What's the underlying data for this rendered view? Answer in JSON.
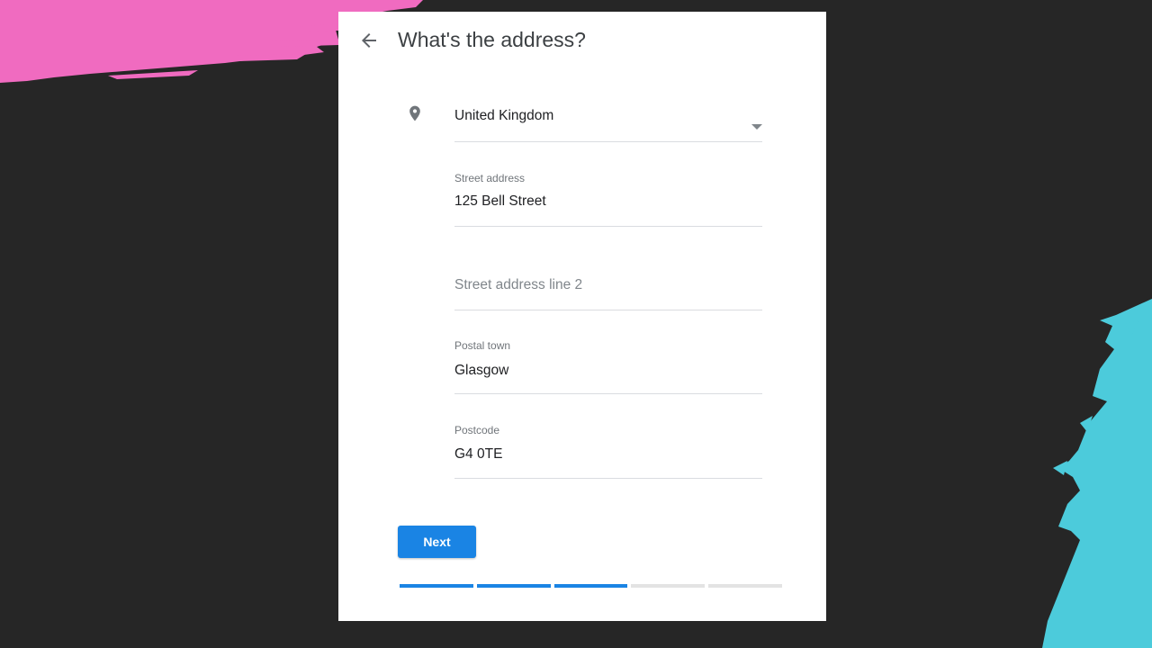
{
  "page": {
    "title": "What's the address?"
  },
  "icons": {
    "back": "arrow-left-icon",
    "location": "location-pin-icon",
    "dropdown": "caret-down-icon"
  },
  "form": {
    "country": {
      "value": "United Kingdom"
    },
    "street_address": {
      "label": "Street address",
      "value": "125 Bell Street"
    },
    "street_address_line_2": {
      "placeholder": "Street address line 2",
      "value": ""
    },
    "postal_town": {
      "label": "Postal town",
      "value": "Glasgow"
    },
    "postcode": {
      "label": "Postcode",
      "value": "G4 0TE"
    }
  },
  "actions": {
    "next_label": "Next"
  },
  "progress": {
    "total_steps": 5,
    "completed_steps": 3
  },
  "colors": {
    "accent": "#1a84e4",
    "brush_pink": "#f06bc0",
    "brush_cyan": "#4ccbdb",
    "background": "#262626"
  }
}
